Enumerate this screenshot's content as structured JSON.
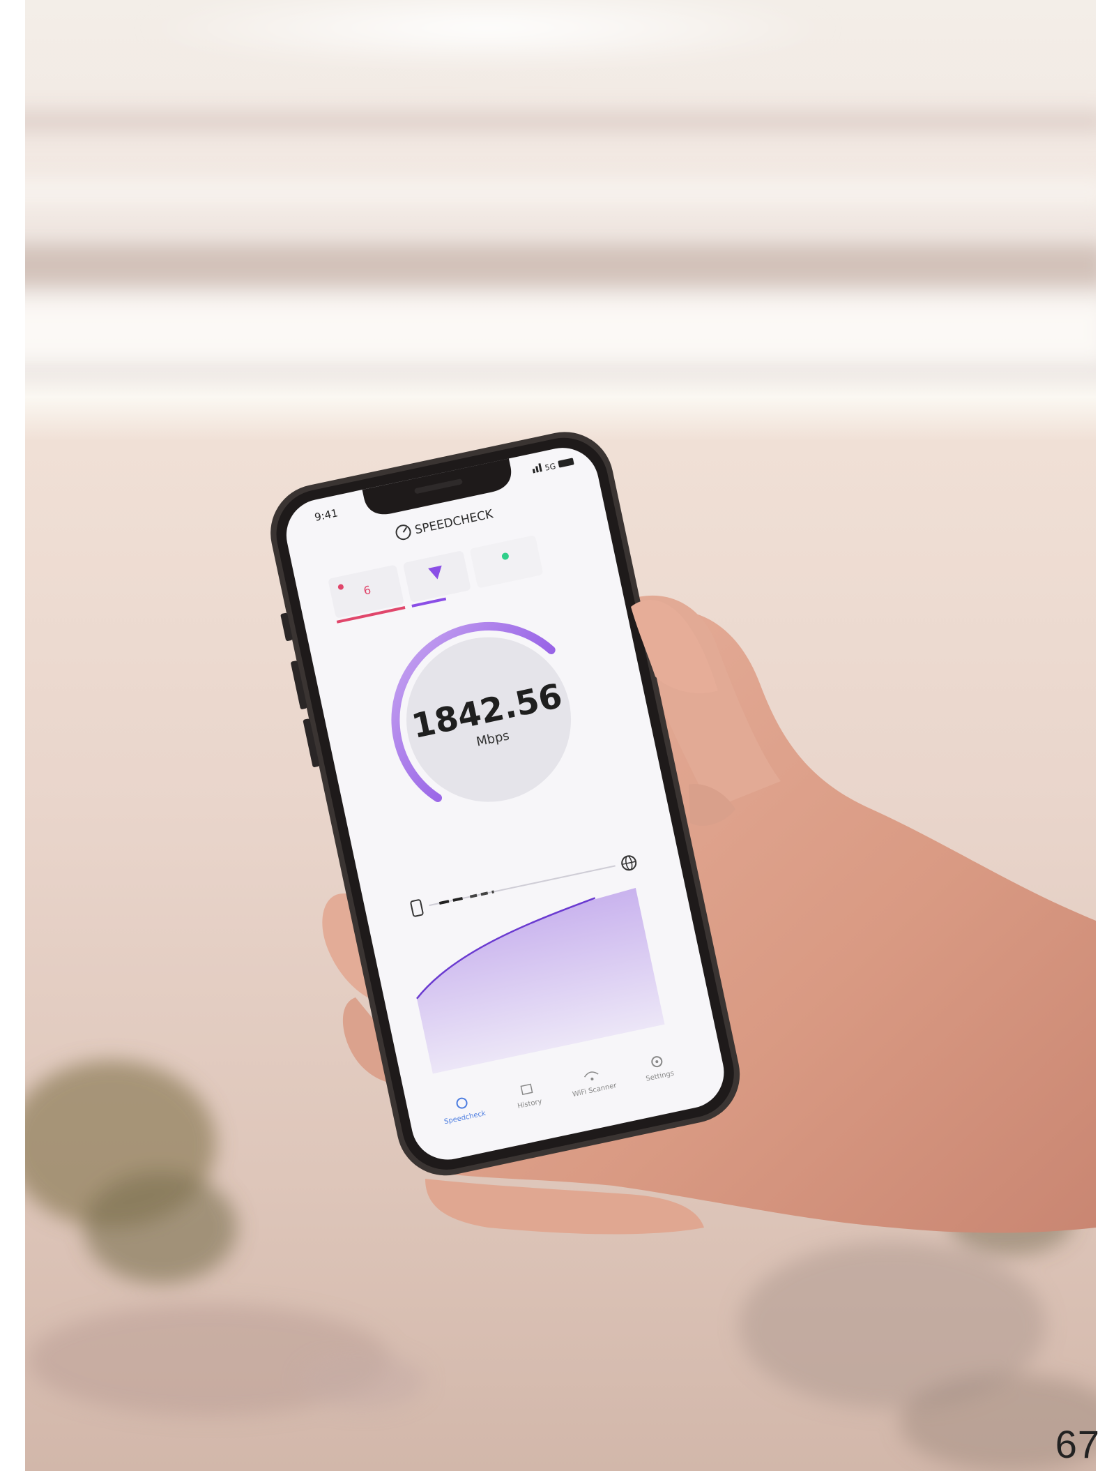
{
  "photo": {
    "scene": "beach",
    "colors": {
      "sky": "#f2ede6",
      "sea": "#e3d7d0",
      "sand": "#e6d2c8",
      "skin": "#e0a58f",
      "phone_frame": "#2e2a29",
      "screen": "#f6f5f8",
      "accent": "#8a4ee6",
      "download_accent": "#e0466b",
      "upload_accent": "#2fcf8a"
    }
  },
  "phone": {
    "status": {
      "time": "9:41",
      "network": "5G"
    },
    "app": {
      "title": "SPEEDCHECK",
      "logo_icon": "speedometer-icon"
    },
    "indicators": [
      {
        "icon": "ping-dot-icon",
        "value": "6"
      },
      {
        "icon": "download-arrow-icon",
        "value": ""
      },
      {
        "icon": "upload-dot-icon",
        "value": ""
      }
    ],
    "gauge": {
      "value": "1842.56",
      "unit": "Mbps",
      "level": 0.7
    },
    "route": {
      "start_icon": "phone-icon",
      "end_icon": "globe-icon"
    },
    "nav": [
      {
        "icon": "speedometer-icon",
        "label": "Speedcheck",
        "active": true
      },
      {
        "icon": "history-icon",
        "label": "History",
        "active": false
      },
      {
        "icon": "wifi-icon",
        "label": "WiFi Scanner",
        "active": false
      },
      {
        "icon": "gear-icon",
        "label": "Settings",
        "active": false
      }
    ]
  },
  "page_number": "67"
}
